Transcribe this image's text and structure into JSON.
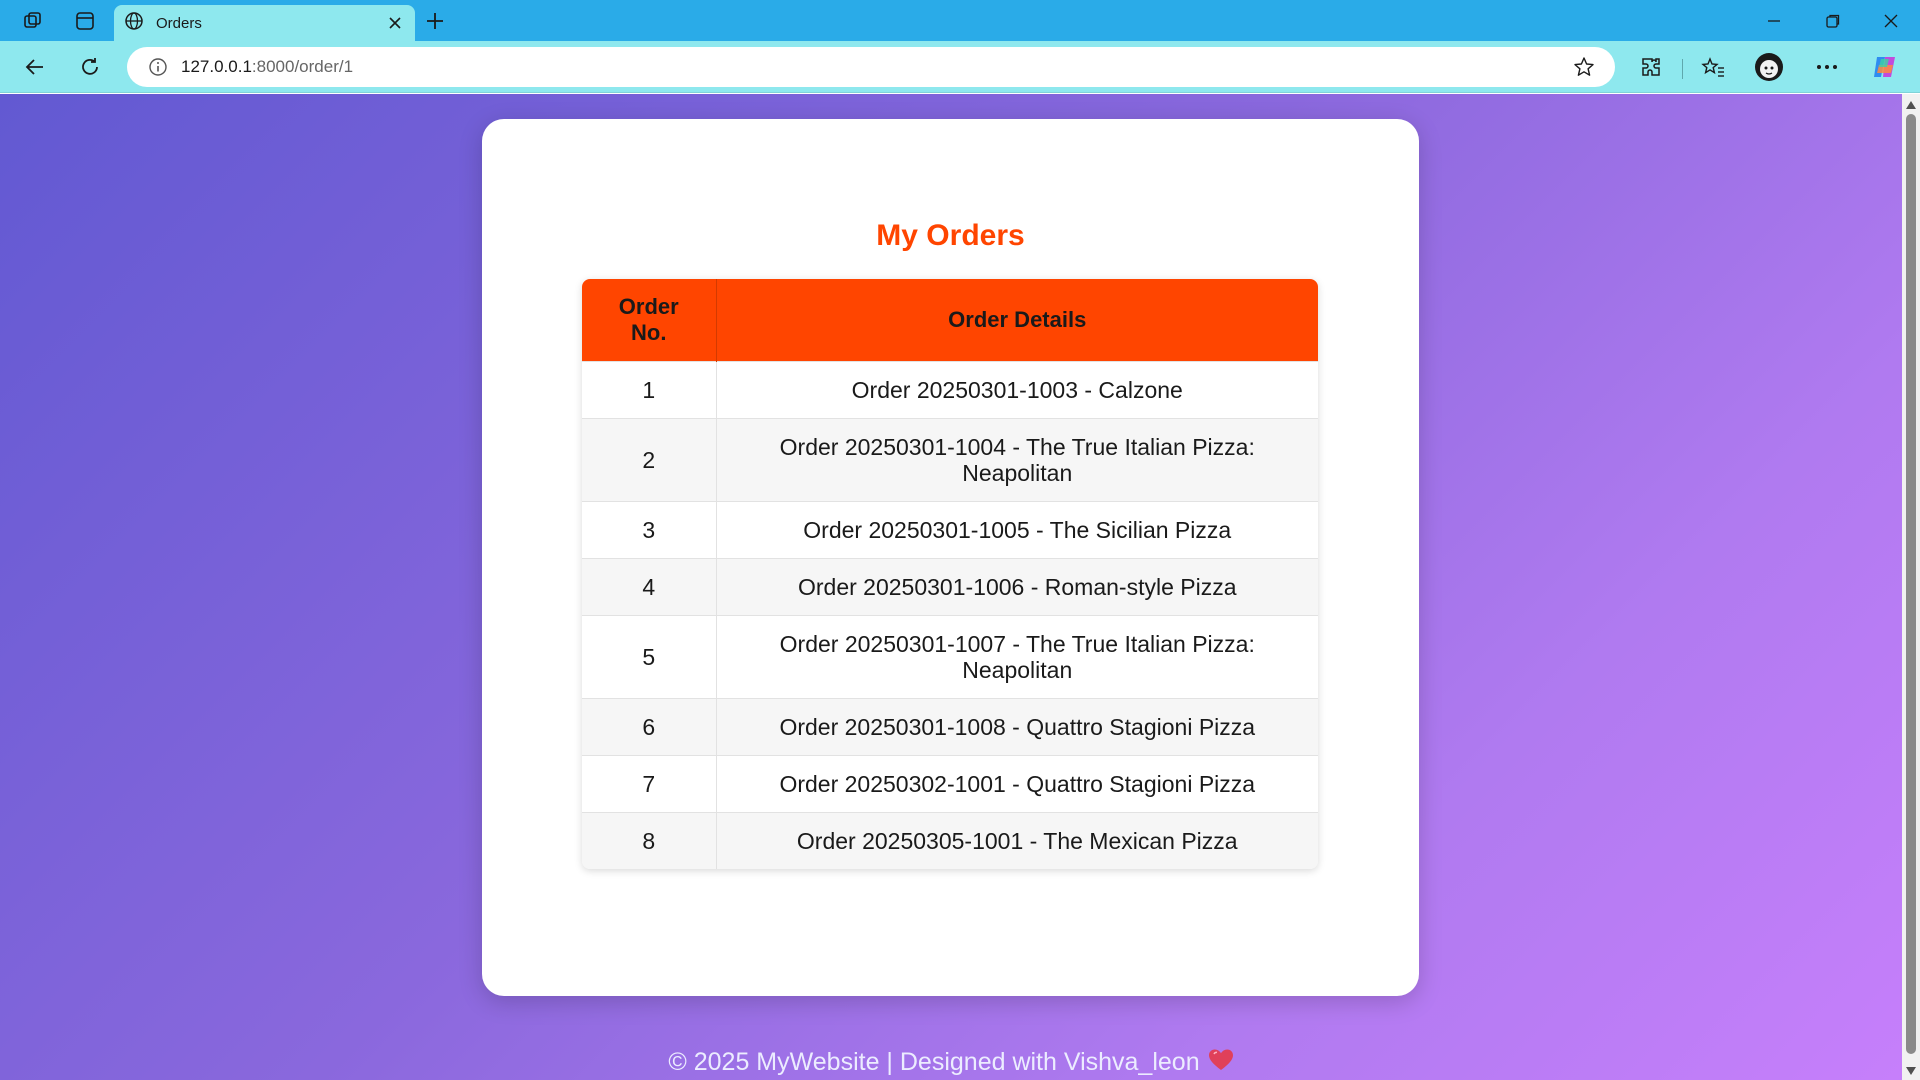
{
  "browser": {
    "tab_title": "Orders",
    "url_host": "127.0.0.1",
    "url_rest": ":8000/order/1"
  },
  "page": {
    "title": "My Orders",
    "table": {
      "headers": [
        "Order No.",
        "Order Details"
      ],
      "rows": [
        {
          "no": "1",
          "details": "Order 20250301-1003 - Calzone"
        },
        {
          "no": "2",
          "details": "Order 20250301-1004 - The True Italian Pizza: Neapolitan"
        },
        {
          "no": "3",
          "details": "Order 20250301-1005 - The Sicilian Pizza"
        },
        {
          "no": "4",
          "details": "Order 20250301-1006 - Roman-style Pizza"
        },
        {
          "no": "5",
          "details": "Order 20250301-1007 - The True Italian Pizza: Neapolitan"
        },
        {
          "no": "6",
          "details": "Order 20250301-1008 - Quattro Stagioni Pizza"
        },
        {
          "no": "7",
          "details": "Order 20250302-1001 - Quattro Stagioni Pizza"
        },
        {
          "no": "8",
          "details": "Order 20250305-1001 - The Mexican Pizza"
        }
      ]
    },
    "footer": "© 2025 MyWebsite | Designed with Vishva_leon"
  },
  "colors": {
    "accent": "#ff4500",
    "tabbar": "#2aabe8",
    "toolbar": "#8ee8ee",
    "heart": "#e0405a"
  },
  "icons": [
    "workspaces-icon",
    "tab-actions-icon",
    "globe-icon",
    "close-icon",
    "plus-icon",
    "minimize-icon",
    "restore-icon",
    "window-close-icon",
    "back-icon",
    "refresh-icon",
    "info-icon",
    "star-icon",
    "extensions-icon",
    "favorites-icon",
    "profile-avatar-icon",
    "more-icon",
    "copilot-icon",
    "heart-icon"
  ]
}
